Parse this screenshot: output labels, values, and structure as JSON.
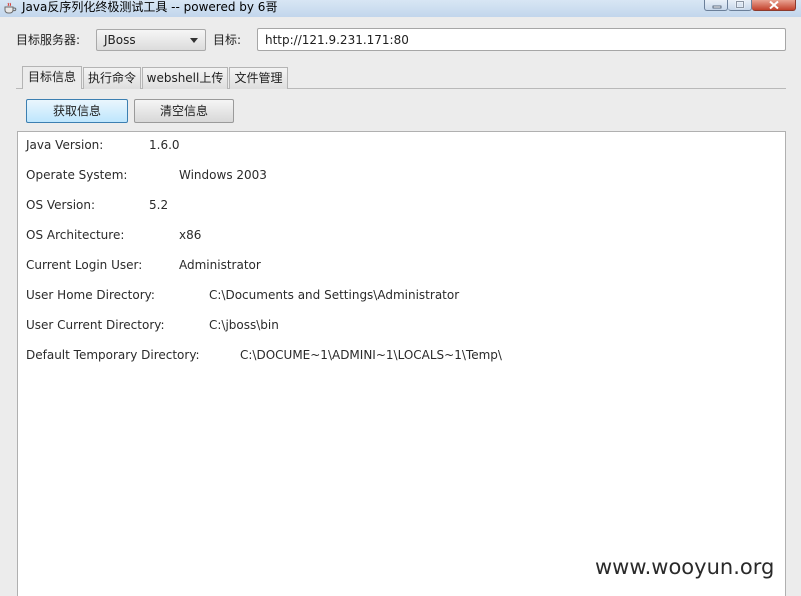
{
  "window": {
    "title": "Java反序列化终极测试工具 -- powered by 6哥"
  },
  "toolbar": {
    "server_label": "目标服务器:",
    "server_value": "JBoss",
    "target_label": "目标:",
    "target_value": "http://121.9.231.171:80"
  },
  "tabs": [
    {
      "label": "目标信息",
      "active": true
    },
    {
      "label": "执行命令",
      "active": false
    },
    {
      "label": "webshell上传",
      "active": false
    },
    {
      "label": "文件管理",
      "active": false
    }
  ],
  "actions": {
    "get_info": "获取信息",
    "clear_info": "清空信息"
  },
  "output": {
    "lines": [
      {
        "key": "Java Version:",
        "value": "1.6.0"
      },
      {
        "key": "Operate System:",
        "value": "Windows 2003"
      },
      {
        "key": "OS Version:",
        "value": "5.2"
      },
      {
        "key": "OS Architecture:",
        "value": "x86"
      },
      {
        "key": "Current Login User:",
        "value": "Administrator"
      },
      {
        "key": "User Home Directory:",
        "value": "C:\\Documents and Settings\\Administrator"
      },
      {
        "key": "User Current Directory:",
        "value": "C:\\jboss\\bin"
      },
      {
        "key": "Default Temporary Directory:",
        "value": "C:\\DOCUME~1\\ADMINI~1\\LOCALS~1\\Temp\\"
      }
    ]
  },
  "watermark": "www.wooyun.org",
  "colors": {
    "titlebar": "#c9dcef",
    "close_button": "#c3412c",
    "primary_button_border": "#3c7fb1"
  }
}
